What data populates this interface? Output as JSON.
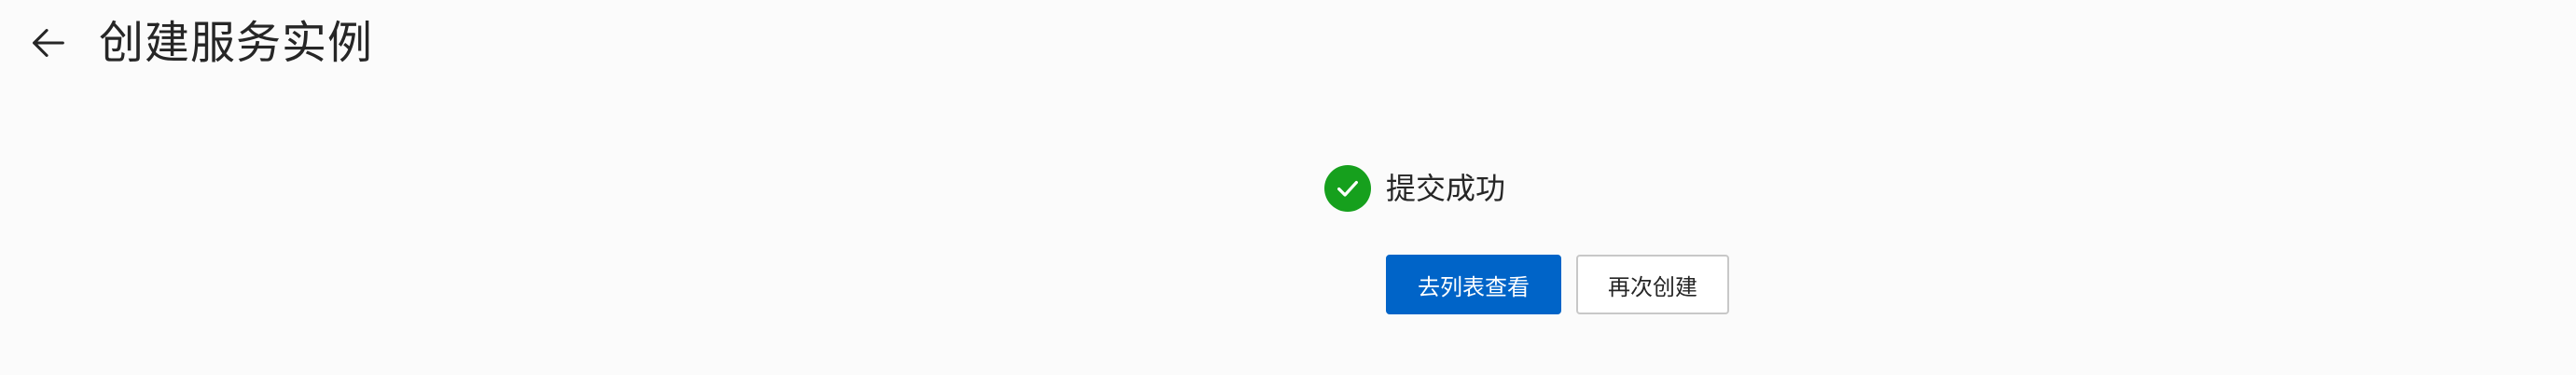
{
  "header": {
    "back_icon": "arrow-left-icon",
    "title": "创建服务实例"
  },
  "result": {
    "icon": "check-circle-icon",
    "icon_color": "#16a01d",
    "message": "提交成功"
  },
  "actions": {
    "primary_label": "去列表查看",
    "primary_color": "#0064c8",
    "secondary_label": "再次创建"
  }
}
